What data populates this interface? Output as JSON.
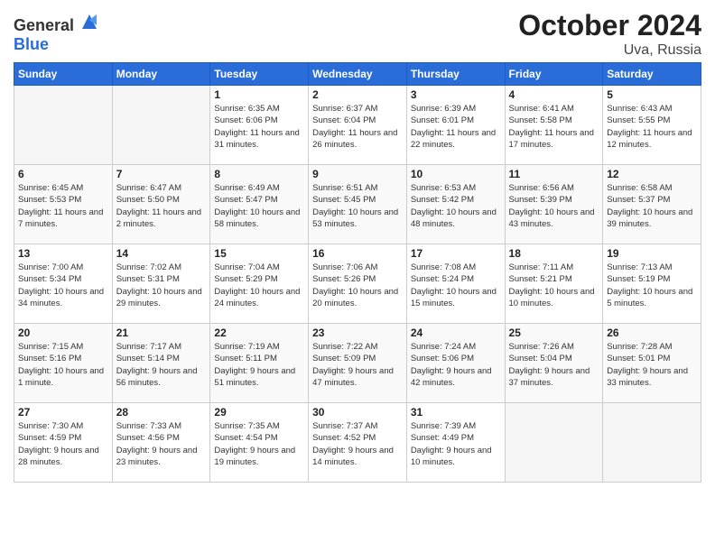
{
  "header": {
    "logo_general": "General",
    "logo_blue": "Blue",
    "title": "October 2024",
    "subtitle": "Uva, Russia"
  },
  "weekdays": [
    "Sunday",
    "Monday",
    "Tuesday",
    "Wednesday",
    "Thursday",
    "Friday",
    "Saturday"
  ],
  "weeks": [
    [
      {
        "day": "",
        "empty": true
      },
      {
        "day": "",
        "empty": true
      },
      {
        "day": "1",
        "sunrise": "6:35 AM",
        "sunset": "6:06 PM",
        "daylight": "11 hours and 31 minutes."
      },
      {
        "day": "2",
        "sunrise": "6:37 AM",
        "sunset": "6:04 PM",
        "daylight": "11 hours and 26 minutes."
      },
      {
        "day": "3",
        "sunrise": "6:39 AM",
        "sunset": "6:01 PM",
        "daylight": "11 hours and 22 minutes."
      },
      {
        "day": "4",
        "sunrise": "6:41 AM",
        "sunset": "5:58 PM",
        "daylight": "11 hours and 17 minutes."
      },
      {
        "day": "5",
        "sunrise": "6:43 AM",
        "sunset": "5:55 PM",
        "daylight": "11 hours and 12 minutes."
      }
    ],
    [
      {
        "day": "6",
        "sunrise": "6:45 AM",
        "sunset": "5:53 PM",
        "daylight": "11 hours and 7 minutes."
      },
      {
        "day": "7",
        "sunrise": "6:47 AM",
        "sunset": "5:50 PM",
        "daylight": "11 hours and 2 minutes."
      },
      {
        "day": "8",
        "sunrise": "6:49 AM",
        "sunset": "5:47 PM",
        "daylight": "10 hours and 58 minutes."
      },
      {
        "day": "9",
        "sunrise": "6:51 AM",
        "sunset": "5:45 PM",
        "daylight": "10 hours and 53 minutes."
      },
      {
        "day": "10",
        "sunrise": "6:53 AM",
        "sunset": "5:42 PM",
        "daylight": "10 hours and 48 minutes."
      },
      {
        "day": "11",
        "sunrise": "6:56 AM",
        "sunset": "5:39 PM",
        "daylight": "10 hours and 43 minutes."
      },
      {
        "day": "12",
        "sunrise": "6:58 AM",
        "sunset": "5:37 PM",
        "daylight": "10 hours and 39 minutes."
      }
    ],
    [
      {
        "day": "13",
        "sunrise": "7:00 AM",
        "sunset": "5:34 PM",
        "daylight": "10 hours and 34 minutes."
      },
      {
        "day": "14",
        "sunrise": "7:02 AM",
        "sunset": "5:31 PM",
        "daylight": "10 hours and 29 minutes."
      },
      {
        "day": "15",
        "sunrise": "7:04 AM",
        "sunset": "5:29 PM",
        "daylight": "10 hours and 24 minutes."
      },
      {
        "day": "16",
        "sunrise": "7:06 AM",
        "sunset": "5:26 PM",
        "daylight": "10 hours and 20 minutes."
      },
      {
        "day": "17",
        "sunrise": "7:08 AM",
        "sunset": "5:24 PM",
        "daylight": "10 hours and 15 minutes."
      },
      {
        "day": "18",
        "sunrise": "7:11 AM",
        "sunset": "5:21 PM",
        "daylight": "10 hours and 10 minutes."
      },
      {
        "day": "19",
        "sunrise": "7:13 AM",
        "sunset": "5:19 PM",
        "daylight": "10 hours and 5 minutes."
      }
    ],
    [
      {
        "day": "20",
        "sunrise": "7:15 AM",
        "sunset": "5:16 PM",
        "daylight": "10 hours and 1 minute."
      },
      {
        "day": "21",
        "sunrise": "7:17 AM",
        "sunset": "5:14 PM",
        "daylight": "9 hours and 56 minutes."
      },
      {
        "day": "22",
        "sunrise": "7:19 AM",
        "sunset": "5:11 PM",
        "daylight": "9 hours and 51 minutes."
      },
      {
        "day": "23",
        "sunrise": "7:22 AM",
        "sunset": "5:09 PM",
        "daylight": "9 hours and 47 minutes."
      },
      {
        "day": "24",
        "sunrise": "7:24 AM",
        "sunset": "5:06 PM",
        "daylight": "9 hours and 42 minutes."
      },
      {
        "day": "25",
        "sunrise": "7:26 AM",
        "sunset": "5:04 PM",
        "daylight": "9 hours and 37 minutes."
      },
      {
        "day": "26",
        "sunrise": "7:28 AM",
        "sunset": "5:01 PM",
        "daylight": "9 hours and 33 minutes."
      }
    ],
    [
      {
        "day": "27",
        "sunrise": "7:30 AM",
        "sunset": "4:59 PM",
        "daylight": "9 hours and 28 minutes."
      },
      {
        "day": "28",
        "sunrise": "7:33 AM",
        "sunset": "4:56 PM",
        "daylight": "9 hours and 23 minutes."
      },
      {
        "day": "29",
        "sunrise": "7:35 AM",
        "sunset": "4:54 PM",
        "daylight": "9 hours and 19 minutes."
      },
      {
        "day": "30",
        "sunrise": "7:37 AM",
        "sunset": "4:52 PM",
        "daylight": "9 hours and 14 minutes."
      },
      {
        "day": "31",
        "sunrise": "7:39 AM",
        "sunset": "4:49 PM",
        "daylight": "9 hours and 10 minutes."
      },
      {
        "day": "",
        "empty": true
      },
      {
        "day": "",
        "empty": true
      }
    ]
  ]
}
